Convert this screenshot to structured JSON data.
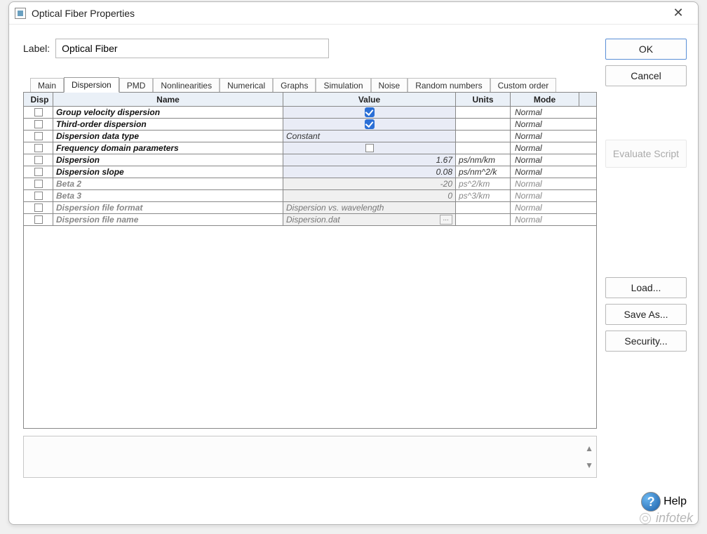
{
  "window": {
    "title": "Optical Fiber Properties"
  },
  "label_row": {
    "text": "Label:",
    "value": "Optical Fiber"
  },
  "tabs": [
    "Main",
    "Dispersion",
    "PMD",
    "Nonlinearities",
    "Numerical",
    "Graphs",
    "Simulation",
    "Noise",
    "Random numbers",
    "Custom order"
  ],
  "active_tab_index": 1,
  "grid": {
    "headers": {
      "disp": "Disp",
      "name": "Name",
      "value": "Value",
      "units": "Units",
      "mode": "Mode"
    },
    "rows": [
      {
        "name": "Group velocity dispersion",
        "value_type": "check-blue",
        "value": "",
        "units": "",
        "mode": "Normal",
        "value_bg": "lav",
        "enabled": true
      },
      {
        "name": "Third-order dispersion",
        "value_type": "check-blue",
        "value": "",
        "units": "",
        "mode": "Normal",
        "value_bg": "lav",
        "enabled": true
      },
      {
        "name": "Dispersion data type",
        "value_type": "text-left",
        "value": "Constant",
        "units": "",
        "mode": "Normal",
        "value_bg": "lav",
        "enabled": true
      },
      {
        "name": "Frequency domain parameters",
        "value_type": "check-empty",
        "value": "",
        "units": "",
        "mode": "Normal",
        "value_bg": "lav",
        "enabled": true
      },
      {
        "name": "Dispersion",
        "value_type": "text-right",
        "value": "1.67",
        "units": "ps/nm/km",
        "mode": "Normal",
        "value_bg": "lav",
        "enabled": true
      },
      {
        "name": "Dispersion slope",
        "value_type": "text-right",
        "value": "0.08",
        "units": "ps/nm^2/k",
        "mode": "Normal",
        "value_bg": "lav",
        "enabled": true
      },
      {
        "name": "Beta 2",
        "value_type": "text-right",
        "value": "-20",
        "units": "ps^2/km",
        "mode": "Normal",
        "value_bg": "grey",
        "enabled": false
      },
      {
        "name": "Beta 3",
        "value_type": "text-right",
        "value": "0",
        "units": "ps^3/km",
        "mode": "Normal",
        "value_bg": "grey",
        "enabled": false
      },
      {
        "name": "Dispersion file format",
        "value_type": "text-left",
        "value": "Dispersion vs. wavelength",
        "units": "",
        "mode": "Normal",
        "value_bg": "grey",
        "enabled": false
      },
      {
        "name": "Dispersion file name",
        "value_type": "file",
        "value": "Dispersion.dat",
        "units": "",
        "mode": "Normal",
        "value_bg": "grey",
        "enabled": false
      }
    ]
  },
  "buttons": {
    "ok": "OK",
    "cancel": "Cancel",
    "evaluate": "Evaluate Script",
    "load": "Load...",
    "save_as": "Save As...",
    "security": "Security...",
    "help": "Help"
  },
  "watermark": "infotek"
}
